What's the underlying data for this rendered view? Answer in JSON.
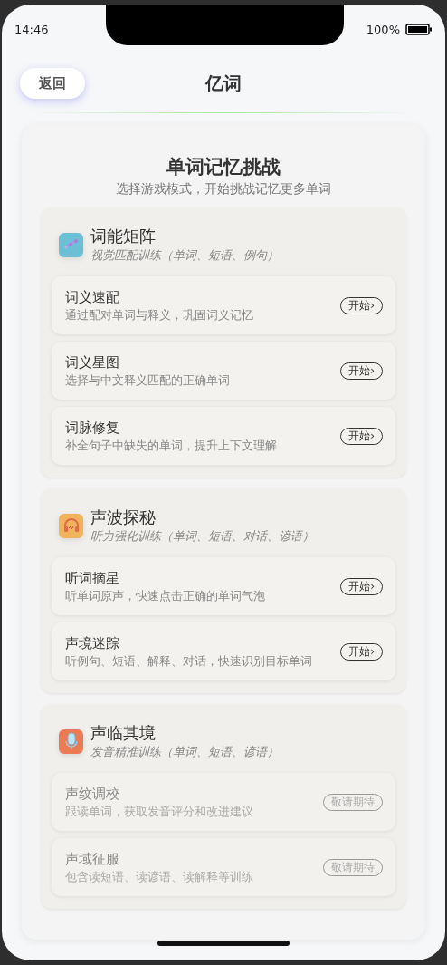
{
  "status_bar": {
    "time": "14:46",
    "battery": "100%"
  },
  "header": {
    "back": "返回",
    "title": "亿词"
  },
  "intro": {
    "title": "单词记忆挑战",
    "subtitle": "选择游戏模式，开始挑战记忆更多单词"
  },
  "sections": [
    {
      "kind": "matrix",
      "title": "词能矩阵",
      "subtitle": "视觉匹配训练（单词、短语、例句）",
      "items": [
        {
          "title": "词义速配",
          "description": "通过配对单词与释义，巩固词义记忆",
          "action": "开始›",
          "disabled": false
        },
        {
          "title": "词义星图",
          "description": "选择与中文释义匹配的正确单词",
          "action": "开始›",
          "disabled": false
        },
        {
          "title": "词脉修复",
          "description": "补全句子中缺失的单词，提升上下文理解",
          "action": "开始›",
          "disabled": false
        }
      ]
    },
    {
      "kind": "headphones",
      "title": "声波探秘",
      "subtitle": "听力强化训练（单词、短语、对话、谚语）",
      "items": [
        {
          "title": "听词摘星",
          "description": "听单词原声，快速点击正确的单词气泡",
          "action": "开始›",
          "disabled": false
        },
        {
          "title": "声境迷踪",
          "description": "听例句、短语、解释、对话，快速识别目标单词",
          "action": "开始›",
          "disabled": false
        }
      ]
    },
    {
      "kind": "mic",
      "title": "声临其境",
      "subtitle": "发音精准训练（单词、短语、谚语）",
      "items": [
        {
          "title": "声纹调校",
          "description": "跟读单词，获取发音评分和改进建议",
          "action": "敬请期待",
          "disabled": true
        },
        {
          "title": "声域征服",
          "description": "包含读短语、读谚语、读解释等训练",
          "action": "敬请期待",
          "disabled": true
        }
      ]
    }
  ]
}
